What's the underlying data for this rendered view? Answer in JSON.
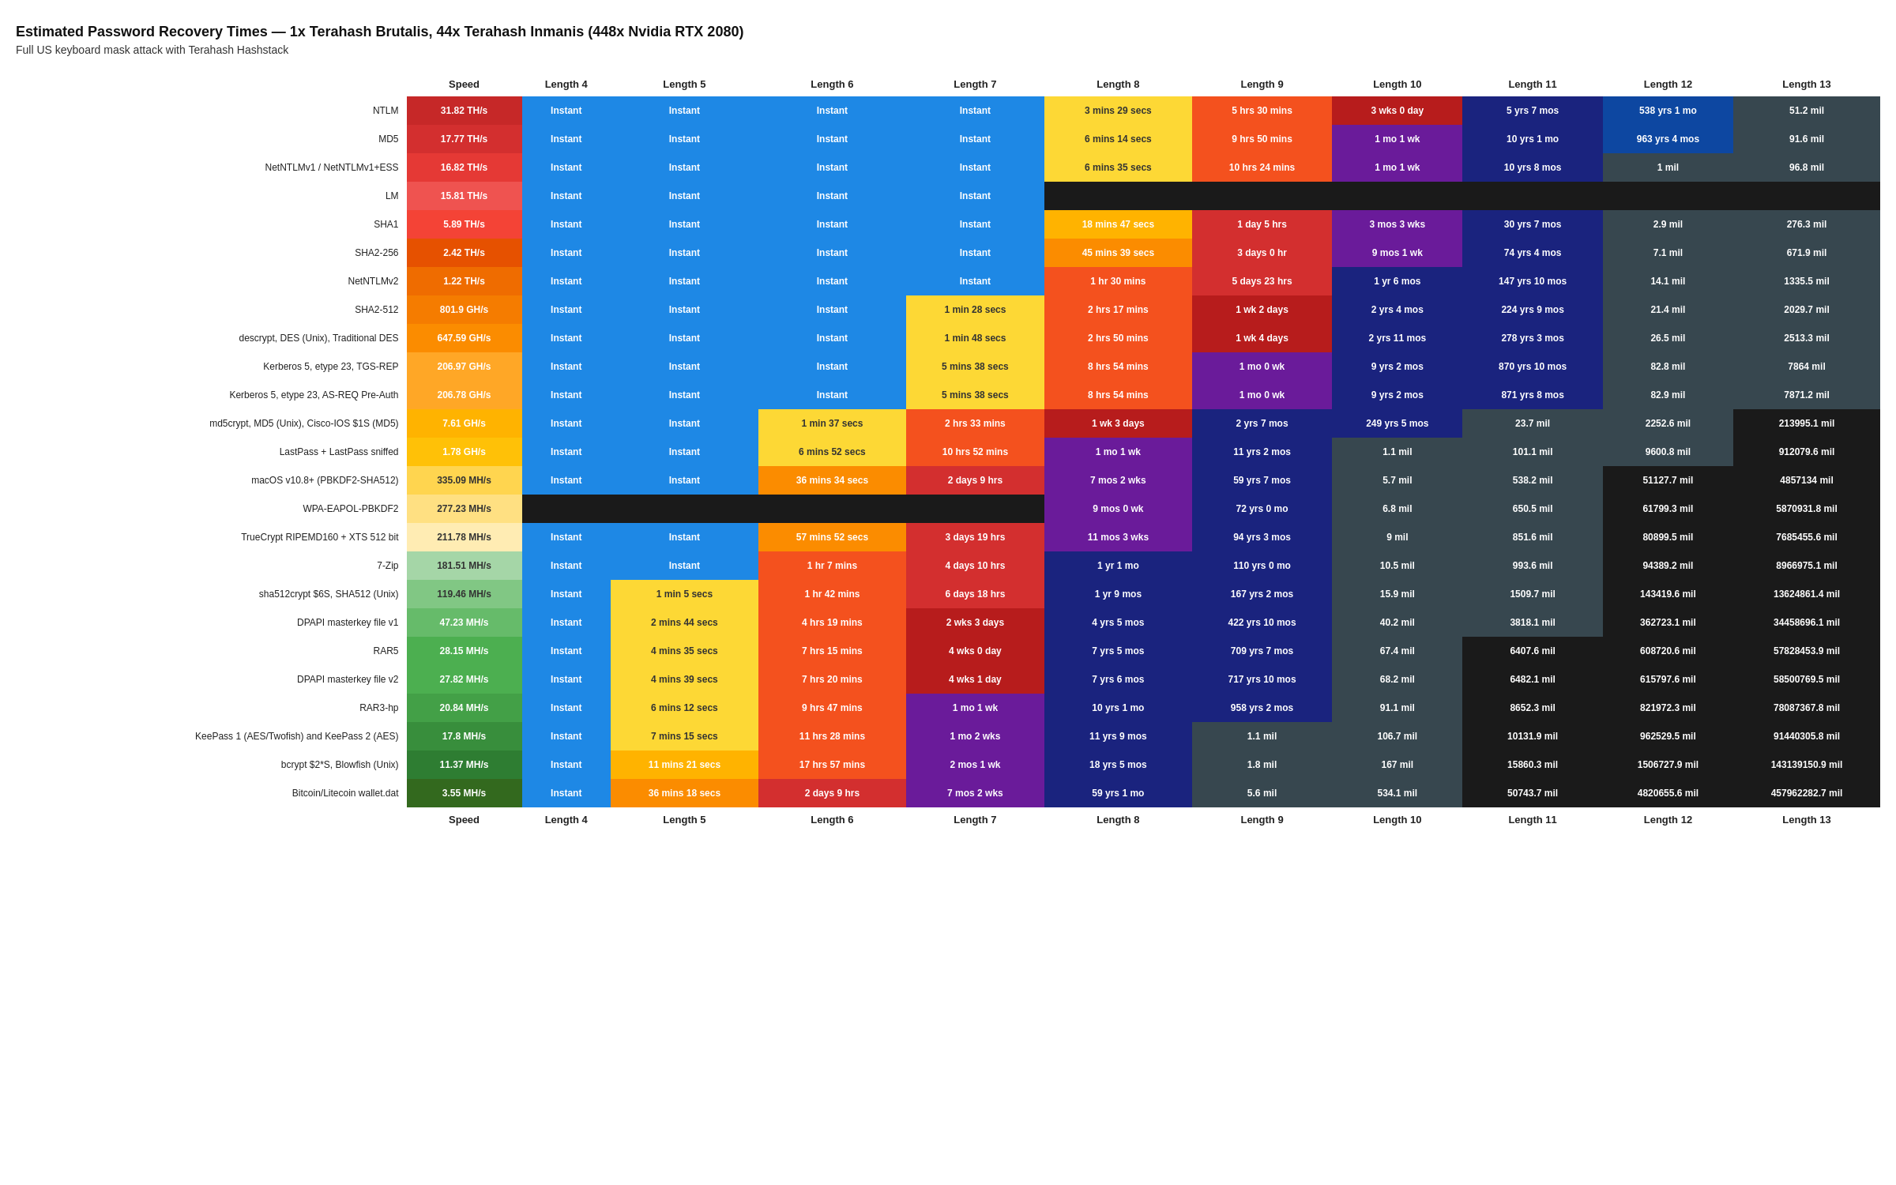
{
  "title": "Estimated Password Recovery Times — 1x Terahash Brutalis, 44x Terahash Inmanis (448x Nvidia RTX 2080)",
  "subtitle": "Full US keyboard mask attack with Terahash Hashstack",
  "columns": [
    "",
    "Speed",
    "Length 4",
    "Length 5",
    "Length 6",
    "Length 7",
    "Length 8",
    "Length 9",
    "Length 10",
    "Length 11",
    "Length 12",
    "Length 13"
  ],
  "rows": [
    {
      "name": "NTLM",
      "speed": "31.82 TH/s",
      "speedClass": "spd1",
      "l4": "Instant",
      "l4c": "t-instant",
      "l5": "Instant",
      "l5c": "t-instant",
      "l6": "Instant",
      "l6c": "t-instant",
      "l7": "Instant",
      "l7c": "t-instant",
      "l8": "3 mins 29 secs",
      "l8c": "t-mins-lo",
      "l9": "5 hrs 30 mins",
      "l9c": "t-hrs-lo",
      "l10": "3 wks 0 day",
      "l10c": "t-wks-lo",
      "l11": "5 yrs 7 mos",
      "l11c": "t-yrs-lo",
      "l12": "538 yrs 1 mo",
      "l12c": "t-yrs-mid",
      "l13": "51.2 mil",
      "l13c": "t-mil-lo"
    },
    {
      "name": "MD5",
      "speed": "17.77 TH/s",
      "speedClass": "spd2",
      "l4": "Instant",
      "l4c": "t-instant",
      "l5": "Instant",
      "l5c": "t-instant",
      "l6": "Instant",
      "l6c": "t-instant",
      "l7": "Instant",
      "l7c": "t-instant",
      "l8": "6 mins 14 secs",
      "l8c": "t-mins-lo",
      "l9": "9 hrs 50 mins",
      "l9c": "t-hrs-lo",
      "l10": "1 mo 1 wk",
      "l10c": "t-mos-lo",
      "l11": "10 yrs 1 mo",
      "l11c": "t-yrs-lo",
      "l12": "963 yrs 4 mos",
      "l12c": "t-yrs-mid",
      "l13": "91.6 mil",
      "l13c": "t-mil-lo"
    },
    {
      "name": "NetNTLMv1 / NetNTLMv1+ESS",
      "speed": "16.82 TH/s",
      "speedClass": "spd3",
      "l4": "Instant",
      "l4c": "t-instant",
      "l5": "Instant",
      "l5c": "t-instant",
      "l6": "Instant",
      "l6c": "t-instant",
      "l7": "Instant",
      "l7c": "t-instant",
      "l8": "6 mins 35 secs",
      "l8c": "t-mins-lo",
      "l9": "10 hrs 24 mins",
      "l9c": "t-hrs-lo",
      "l10": "1 mo 1 wk",
      "l10c": "t-mos-lo",
      "l11": "10 yrs 8 mos",
      "l11c": "t-yrs-lo",
      "l12": "1 mil",
      "l12c": "t-mil-lo",
      "l13": "96.8 mil",
      "l13c": "t-mil-lo"
    },
    {
      "name": "LM",
      "speed": "15.81 TH/s",
      "speedClass": "spd4",
      "l4": "Instant",
      "l4c": "t-instant",
      "l5": "Instant",
      "l5c": "t-instant",
      "l6": "Instant",
      "l6c": "t-instant",
      "l7": "Instant",
      "l7c": "t-instant",
      "l8": "",
      "l8c": "t-mil-hi",
      "l9": "",
      "l9c": "t-mil-hi",
      "l10": "",
      "l10c": "t-mil-hi",
      "l11": "",
      "l11c": "t-mil-hi",
      "l12": "",
      "l12c": "t-mil-hi",
      "l13": "",
      "l13c": "t-mil-hi"
    },
    {
      "name": "SHA1",
      "speed": "5.89 TH/s",
      "speedClass": "spd5",
      "l4": "Instant",
      "l4c": "t-instant",
      "l5": "Instant",
      "l5c": "t-instant",
      "l6": "Instant",
      "l6c": "t-instant",
      "l7": "Instant",
      "l7c": "t-instant",
      "l8": "18 mins 47 secs",
      "l8c": "t-mins-mid",
      "l9": "1 day 5 hrs",
      "l9c": "t-days-lo",
      "l10": "3 mos 3 wks",
      "l10c": "t-mos-lo",
      "l11": "30 yrs 7 mos",
      "l11c": "t-yrs-lo",
      "l12": "2.9 mil",
      "l12c": "t-mil-lo",
      "l13": "276.3 mil",
      "l13c": "t-mil-lo"
    },
    {
      "name": "SHA2-256",
      "speed": "2.42 TH/s",
      "speedClass": "spd6",
      "l4": "Instant",
      "l4c": "t-instant",
      "l5": "Instant",
      "l5c": "t-instant",
      "l6": "Instant",
      "l6c": "t-instant",
      "l7": "Instant",
      "l7c": "t-instant",
      "l8": "45 mins 39 secs",
      "l8c": "t-mins-hi",
      "l9": "3 days 0 hr",
      "l9c": "t-days-lo",
      "l10": "9 mos 1 wk",
      "l10c": "t-mos-lo",
      "l11": "74 yrs 4 mos",
      "l11c": "t-yrs-lo",
      "l12": "7.1 mil",
      "l12c": "t-mil-lo",
      "l13": "671.9 mil",
      "l13c": "t-mil-lo"
    },
    {
      "name": "NetNTLMv2",
      "speed": "1.22 TH/s",
      "speedClass": "spd7",
      "l4": "Instant",
      "l4c": "t-instant",
      "l5": "Instant",
      "l5c": "t-instant",
      "l6": "Instant",
      "l6c": "t-instant",
      "l7": "Instant",
      "l7c": "t-instant",
      "l8": "1 hr 30 mins",
      "l8c": "t-hrs-lo",
      "l9": "5 days 23 hrs",
      "l9c": "t-days-lo",
      "l10": "1 yr 6 mos",
      "l10c": "t-yrs-lo",
      "l11": "147 yrs 10 mos",
      "l11c": "t-yrs-lo",
      "l12": "14.1 mil",
      "l12c": "t-mil-lo",
      "l13": "1335.5 mil",
      "l13c": "t-mil-lo"
    },
    {
      "name": "SHA2-512",
      "speed": "801.9 GH/s",
      "speedClass": "spd8",
      "l4": "Instant",
      "l4c": "t-instant",
      "l5": "Instant",
      "l5c": "t-instant",
      "l6": "Instant",
      "l6c": "t-instant",
      "l7": "1 min 28 secs",
      "l7c": "t-mins-lo",
      "l8": "2 hrs 17 mins",
      "l8c": "t-hrs-lo",
      "l9": "1 wk 2 days",
      "l9c": "t-wks-lo",
      "l10": "2 yrs 4 mos",
      "l10c": "t-yrs-lo",
      "l11": "224 yrs 9 mos",
      "l11c": "t-yrs-lo",
      "l12": "21.4 mil",
      "l12c": "t-mil-lo",
      "l13": "2029.7 mil",
      "l13c": "t-mil-lo"
    },
    {
      "name": "descrypt, DES (Unix), Traditional DES",
      "speed": "647.59 GH/s",
      "speedClass": "spd9",
      "l4": "Instant",
      "l4c": "t-instant",
      "l5": "Instant",
      "l5c": "t-instant",
      "l6": "Instant",
      "l6c": "t-instant",
      "l7": "1 min 48 secs",
      "l7c": "t-mins-lo",
      "l8": "2 hrs 50 mins",
      "l8c": "t-hrs-lo",
      "l9": "1 wk 4 days",
      "l9c": "t-wks-lo",
      "l10": "2 yrs 11 mos",
      "l10c": "t-yrs-lo",
      "l11": "278 yrs 3 mos",
      "l11c": "t-yrs-lo",
      "l12": "26.5 mil",
      "l12c": "t-mil-lo",
      "l13": "2513.3 mil",
      "l13c": "t-mil-lo"
    },
    {
      "name": "Kerberos 5, etype 23, TGS-REP",
      "speed": "206.97 GH/s",
      "speedClass": "spd10",
      "l4": "Instant",
      "l4c": "t-instant",
      "l5": "Instant",
      "l5c": "t-instant",
      "l6": "Instant",
      "l6c": "t-instant",
      "l7": "5 mins 38 secs",
      "l7c": "t-mins-lo",
      "l8": "8 hrs 54 mins",
      "l8c": "t-hrs-lo",
      "l9": "1 mo 0 wk",
      "l9c": "t-mos-lo",
      "l10": "9 yrs 2 mos",
      "l10c": "t-yrs-lo",
      "l11": "870 yrs 10 mos",
      "l11c": "t-yrs-lo",
      "l12": "82.8 mil",
      "l12c": "t-mil-lo",
      "l13": "7864 mil",
      "l13c": "t-mil-lo"
    },
    {
      "name": "Kerberos 5, etype 23, AS-REQ Pre-Auth",
      "speed": "206.78 GH/s",
      "speedClass": "spd10",
      "l4": "Instant",
      "l4c": "t-instant",
      "l5": "Instant",
      "l5c": "t-instant",
      "l6": "Instant",
      "l6c": "t-instant",
      "l7": "5 mins 38 secs",
      "l7c": "t-mins-lo",
      "l8": "8 hrs 54 mins",
      "l8c": "t-hrs-lo",
      "l9": "1 mo 0 wk",
      "l9c": "t-mos-lo",
      "l10": "9 yrs 2 mos",
      "l10c": "t-yrs-lo",
      "l11": "871 yrs 8 mos",
      "l11c": "t-yrs-lo",
      "l12": "82.9 mil",
      "l12c": "t-mil-lo",
      "l13": "7871.2 mil",
      "l13c": "t-mil-lo"
    },
    {
      "name": "md5crypt, MD5 (Unix), Cisco-IOS $1S (MD5)",
      "speed": "7.61 GH/s",
      "speedClass": "spd11",
      "l4": "Instant",
      "l4c": "t-instant",
      "l5": "Instant",
      "l5c": "t-instant",
      "l6": "1 min 37 secs",
      "l6c": "t-mins-lo",
      "l7": "2 hrs 33 mins",
      "l7c": "t-hrs-lo",
      "l8": "1 wk 3 days",
      "l8c": "t-wks-lo",
      "l9": "2 yrs 7 mos",
      "l9c": "t-yrs-lo",
      "l10": "249 yrs 5 mos",
      "l10c": "t-yrs-lo",
      "l11": "23.7 mil",
      "l11c": "t-mil-lo",
      "l12": "2252.6 mil",
      "l12c": "t-mil-lo",
      "l13": "213995.1 mil",
      "l13c": "t-mil-hi"
    },
    {
      "name": "LastPass + LastPass sniffed",
      "speed": "1.78 GH/s",
      "speedClass": "spd12",
      "l4": "Instant",
      "l4c": "t-instant",
      "l5": "Instant",
      "l5c": "t-instant",
      "l6": "6 mins 52 secs",
      "l6c": "t-mins-lo",
      "l7": "10 hrs 52 mins",
      "l7c": "t-hrs-lo",
      "l8": "1 mo 1 wk",
      "l8c": "t-mos-lo",
      "l9": "11 yrs 2 mos",
      "l9c": "t-yrs-lo",
      "l10": "1.1 mil",
      "l10c": "t-mil-lo",
      "l11": "101.1 mil",
      "l11c": "t-mil-lo",
      "l12": "9600.8 mil",
      "l12c": "t-mil-lo",
      "l13": "912079.6 mil",
      "l13c": "t-mil-hi"
    },
    {
      "name": "macOS v10.8+ (PBKDF2-SHA512)",
      "speed": "335.09 MH/s",
      "speedClass": "spd13",
      "l4": "Instant",
      "l4c": "t-instant",
      "l5": "Instant",
      "l5c": "t-instant",
      "l6": "36 mins 34 secs",
      "l6c": "t-mins-hi",
      "l7": "2 days 9 hrs",
      "l7c": "t-days-lo",
      "l8": "7 mos 2 wks",
      "l8c": "t-mos-lo",
      "l9": "59 yrs 7 mos",
      "l9c": "t-yrs-lo",
      "l10": "5.7 mil",
      "l10c": "t-mil-lo",
      "l11": "538.2 mil",
      "l11c": "t-mil-lo",
      "l12": "51127.7 mil",
      "l12c": "t-mil-hi",
      "l13": "4857134 mil",
      "l13c": "t-mil-hi"
    },
    {
      "name": "WPA-EAPOL-PBKDF2",
      "speed": "277.23 MH/s",
      "speedClass": "spd14",
      "l4": "",
      "l4c": "t-mil-hi",
      "l5": "",
      "l5c": "t-mil-hi",
      "l6": "",
      "l6c": "t-mil-hi",
      "l7": "",
      "l7c": "t-mil-hi",
      "l8": "9 mos 0 wk",
      "l8c": "t-mos-lo",
      "l9": "72 yrs 0 mo",
      "l9c": "t-yrs-lo",
      "l10": "6.8 mil",
      "l10c": "t-mil-lo",
      "l11": "650.5 mil",
      "l11c": "t-mil-lo",
      "l12": "61799.3 mil",
      "l12c": "t-mil-hi",
      "l13": "5870931.8 mil",
      "l13c": "t-mil-hi"
    },
    {
      "name": "TrueCrypt RIPEMD160 + XTS 512 bit",
      "speed": "211.78 MH/s",
      "speedClass": "spd15",
      "l4": "Instant",
      "l4c": "t-instant",
      "l5": "Instant",
      "l5c": "t-instant",
      "l6": "57 mins 52 secs",
      "l6c": "t-mins-hi",
      "l7": "3 days 19 hrs",
      "l7c": "t-days-lo",
      "l8": "11 mos 3 wks",
      "l8c": "t-mos-lo",
      "l9": "94 yrs 3 mos",
      "l9c": "t-yrs-lo",
      "l10": "9 mil",
      "l10c": "t-mil-lo",
      "l11": "851.6 mil",
      "l11c": "t-mil-lo",
      "l12": "80899.5 mil",
      "l12c": "t-mil-hi",
      "l13": "7685455.6 mil",
      "l13c": "t-mil-hi"
    },
    {
      "name": "7-Zip",
      "speed": "181.51 MH/s",
      "speedClass": "spd16",
      "l4": "Instant",
      "l4c": "t-instant",
      "l5": "Instant",
      "l5c": "t-instant",
      "l6": "1 hr 7 mins",
      "l6c": "t-hrs-lo",
      "l7": "4 days 10 hrs",
      "l7c": "t-days-lo",
      "l8": "1 yr 1 mo",
      "l8c": "t-yrs-lo",
      "l9": "110 yrs 0 mo",
      "l9c": "t-yrs-lo",
      "l10": "10.5 mil",
      "l10c": "t-mil-lo",
      "l11": "993.6 mil",
      "l11c": "t-mil-lo",
      "l12": "94389.2 mil",
      "l12c": "t-mil-hi",
      "l13": "8966975.1 mil",
      "l13c": "t-mil-hi"
    },
    {
      "name": "sha512crypt $6S, SHA512 (Unix)",
      "speed": "119.46 MH/s",
      "speedClass": "spd17",
      "l4": "Instant",
      "l4c": "t-instant",
      "l5": "1 min 5 secs",
      "l5c": "t-mins-lo",
      "l6": "1 hr 42 mins",
      "l6c": "t-hrs-lo",
      "l7": "6 days 18 hrs",
      "l7c": "t-days-lo",
      "l8": "1 yr 9 mos",
      "l8c": "t-yrs-lo",
      "l9": "167 yrs 2 mos",
      "l9c": "t-yrs-lo",
      "l10": "15.9 mil",
      "l10c": "t-mil-lo",
      "l11": "1509.7 mil",
      "l11c": "t-mil-lo",
      "l12": "143419.6 mil",
      "l12c": "t-mil-hi",
      "l13": "13624861.4 mil",
      "l13c": "t-mil-hi"
    },
    {
      "name": "DPAPI masterkey file v1",
      "speed": "47.23 MH/s",
      "speedClass": "spd18",
      "l4": "Instant",
      "l4c": "t-instant",
      "l5": "2 mins 44 secs",
      "l5c": "t-mins-lo",
      "l6": "4 hrs 19 mins",
      "l6c": "t-hrs-lo",
      "l7": "2 wks 3 days",
      "l7c": "t-wks-lo",
      "l8": "4 yrs 5 mos",
      "l8c": "t-yrs-lo",
      "l9": "422 yrs 10 mos",
      "l9c": "t-yrs-lo",
      "l10": "40.2 mil",
      "l10c": "t-mil-lo",
      "l11": "3818.1 mil",
      "l11c": "t-mil-lo",
      "l12": "362723.1 mil",
      "l12c": "t-mil-hi",
      "l13": "34458696.1 mil",
      "l13c": "t-mil-hi"
    },
    {
      "name": "RAR5",
      "speed": "28.15 MH/s",
      "speedClass": "spd19",
      "l4": "Instant",
      "l4c": "t-instant",
      "l5": "4 mins 35 secs",
      "l5c": "t-mins-lo",
      "l6": "7 hrs 15 mins",
      "l6c": "t-hrs-lo",
      "l7": "4 wks 0 day",
      "l7c": "t-wks-lo",
      "l8": "7 yrs 5 mos",
      "l8c": "t-yrs-lo",
      "l9": "709 yrs 7 mos",
      "l9c": "t-yrs-lo",
      "l10": "67.4 mil",
      "l10c": "t-mil-lo",
      "l11": "6407.6 mil",
      "l11c": "t-mil-hi",
      "l12": "608720.6 mil",
      "l12c": "t-mil-hi",
      "l13": "57828453.9 mil",
      "l13c": "t-mil-hi"
    },
    {
      "name": "DPAPI masterkey file v2",
      "speed": "27.82 MH/s",
      "speedClass": "spd19",
      "l4": "Instant",
      "l4c": "t-instant",
      "l5": "4 mins 39 secs",
      "l5c": "t-mins-lo",
      "l6": "7 hrs 20 mins",
      "l6c": "t-hrs-lo",
      "l7": "4 wks 1 day",
      "l7c": "t-wks-lo",
      "l8": "7 yrs 6 mos",
      "l8c": "t-yrs-lo",
      "l9": "717 yrs 10 mos",
      "l9c": "t-yrs-lo",
      "l10": "68.2 mil",
      "l10c": "t-mil-lo",
      "l11": "6482.1 mil",
      "l11c": "t-mil-hi",
      "l12": "615797.6 mil",
      "l12c": "t-mil-hi",
      "l13": "58500769.5 mil",
      "l13c": "t-mil-hi"
    },
    {
      "name": "RAR3-hp",
      "speed": "20.84 MH/s",
      "speedClass": "spd20",
      "l4": "Instant",
      "l4c": "t-instant",
      "l5": "6 mins 12 secs",
      "l5c": "t-mins-lo",
      "l6": "9 hrs 47 mins",
      "l6c": "t-hrs-lo",
      "l7": "1 mo 1 wk",
      "l7c": "t-mos-lo",
      "l8": "10 yrs 1 mo",
      "l8c": "t-yrs-lo",
      "l9": "958 yrs 2 mos",
      "l9c": "t-yrs-lo",
      "l10": "91.1 mil",
      "l10c": "t-mil-lo",
      "l11": "8652.3 mil",
      "l11c": "t-mil-hi",
      "l12": "821972.3 mil",
      "l12c": "t-mil-hi",
      "l13": "78087367.8 mil",
      "l13c": "t-mil-hi"
    },
    {
      "name": "KeePass 1 (AES/Twofish) and KeePass 2 (AES)",
      "speed": "17.8 MH/s",
      "speedClass": "spd21",
      "l4": "Instant",
      "l4c": "t-instant",
      "l5": "7 mins 15 secs",
      "l5c": "t-mins-lo",
      "l6": "11 hrs 28 mins",
      "l6c": "t-hrs-lo",
      "l7": "1 mo 2 wks",
      "l7c": "t-mos-lo",
      "l8": "11 yrs 9 mos",
      "l8c": "t-yrs-lo",
      "l9": "1.1 mil",
      "l9c": "t-mil-lo",
      "l10": "106.7 mil",
      "l10c": "t-mil-lo",
      "l11": "10131.9 mil",
      "l11c": "t-mil-hi",
      "l12": "962529.5 mil",
      "l12c": "t-mil-hi",
      "l13": "91440305.8 mil",
      "l13c": "t-mil-hi"
    },
    {
      "name": "bcrypt $2*S, Blowfish (Unix)",
      "speed": "11.37 MH/s",
      "speedClass": "spd22",
      "l4": "Instant",
      "l4c": "t-instant",
      "l5": "11 mins 21 secs",
      "l5c": "t-mins-mid",
      "l6": "17 hrs 57 mins",
      "l6c": "t-hrs-lo",
      "l7": "2 mos 1 wk",
      "l7c": "t-mos-lo",
      "l8": "18 yrs 5 mos",
      "l8c": "t-yrs-lo",
      "l9": "1.8 mil",
      "l9c": "t-mil-lo",
      "l10": "167 mil",
      "l10c": "t-mil-lo",
      "l11": "15860.3 mil",
      "l11c": "t-mil-hi",
      "l12": "1506727.9 mil",
      "l12c": "t-mil-hi",
      "l13": "143139150.9 mil",
      "l13c": "t-mil-hi"
    },
    {
      "name": "Bitcoin/Litecoin wallet.dat",
      "speed": "3.55 MH/s",
      "speedClass": "spd24",
      "l4": "Instant",
      "l4c": "t-instant",
      "l5": "36 mins 18 secs",
      "l5c": "t-mins-hi",
      "l6": "2 days 9 hrs",
      "l6c": "t-days-lo",
      "l7": "7 mos 2 wks",
      "l7c": "t-mos-lo",
      "l8": "59 yrs 1 mo",
      "l8c": "t-yrs-lo",
      "l9": "5.6 mil",
      "l9c": "t-mil-lo",
      "l10": "534.1 mil",
      "l10c": "t-mil-lo",
      "l11": "50743.7 mil",
      "l11c": "t-mil-hi",
      "l12": "4820655.6 mil",
      "l12c": "t-mil-hi",
      "l13": "457962282.7 mil",
      "l13c": "t-mil-hi"
    }
  ]
}
